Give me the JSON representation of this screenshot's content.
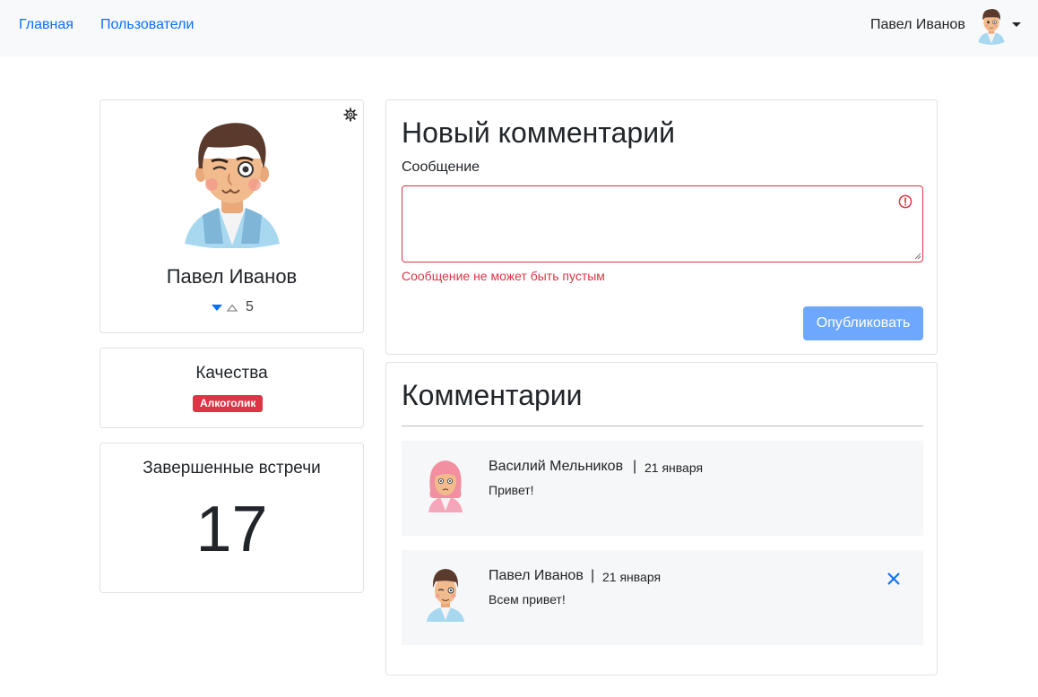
{
  "navbar": {
    "links": [
      "Главная",
      "Пользователи"
    ],
    "user_name": "Павел Иванов",
    "avatar_icon": "male-avatar-icon",
    "caret_icon": "caret-down-icon"
  },
  "profile": {
    "name": "Павел Иванов",
    "rating": "5",
    "settings_icon": "gear-icon"
  },
  "qualities": {
    "title": "Качества",
    "badges": [
      "Алкоголик"
    ],
    "badge_color": "#dc3545"
  },
  "meetings": {
    "title": "Завершенные встречи",
    "count": "17"
  },
  "new_comment": {
    "title": "Новый комментарий",
    "field_label": "Сообщение",
    "value": "",
    "error": "Сообщение не может быть пустым",
    "submit_label": "Опубликовать"
  },
  "comments": {
    "title": "Комментарии",
    "items": [
      {
        "author": "Василий Мельников",
        "date": "21 января",
        "text": "Привет!",
        "avatar": "female-avatar-icon",
        "deletable": false
      },
      {
        "author": "Павел Иванов",
        "date": "21 января",
        "text": "Всем привет!",
        "avatar": "male-avatar-icon",
        "deletable": true
      }
    ]
  },
  "colors": {
    "link": "#0d6efd",
    "danger": "#dc3545",
    "button": "#6ea8fe",
    "navbar_bg": "#f8f9fa",
    "comment_bg": "#f6f7f8"
  }
}
